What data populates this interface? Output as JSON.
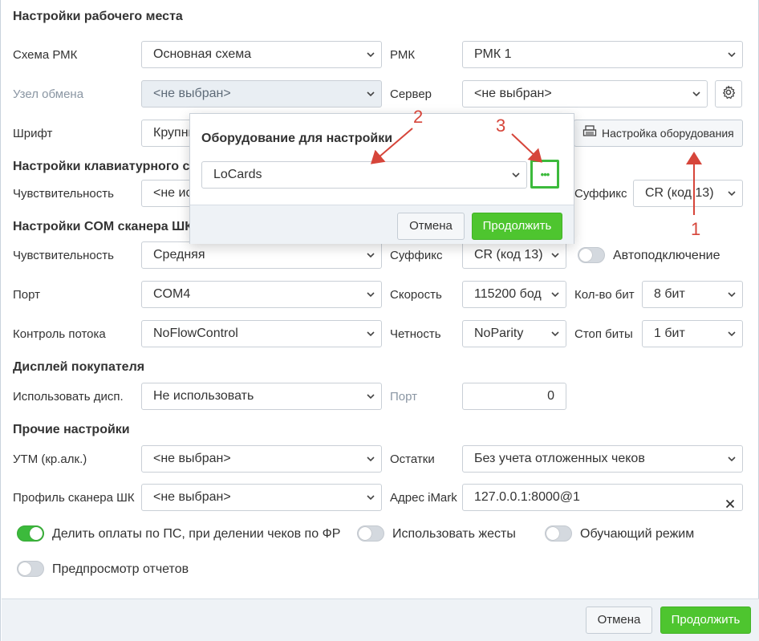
{
  "sections": {
    "workplace": "Настройки рабочего места",
    "keyboard": "Настройки клавиатурного с",
    "com_scanner": "Настройки COM сканера ШК",
    "display": "Дисплей покупателя",
    "other": "Прочие настройки"
  },
  "workplace": {
    "scheme_label": "Схема РМК",
    "scheme_value": "Основная схема",
    "rmk_label": "РМК",
    "rmk_value": "РМК 1",
    "node_label": "Узел обмена",
    "node_value": "<не выбран>",
    "server_label": "Сервер",
    "server_value": "<не выбран>",
    "font_label": "Шрифт",
    "font_value": "Крупны",
    "equipment_button": "Настройка оборудования"
  },
  "keyboard": {
    "sensitivity_label": "Чувствительность",
    "sensitivity_value": "<не ис",
    "suffix_label": "Суффикс",
    "suffix_value": "CR (код 13)"
  },
  "com": {
    "sensitivity_label": "Чувствительность",
    "sensitivity_value": "Средняя",
    "suffix_label": "Суффикс",
    "suffix_value": "CR (код 13)",
    "autoconnect_label": "Автоподключение",
    "autoconnect_on": false,
    "port_label": "Порт",
    "port_value": "COM4",
    "speed_label": "Скорость",
    "speed_value": "115200 бод",
    "bits_label": "Кол-во бит",
    "bits_value": "8 бит",
    "flow_label": "Контроль потока",
    "flow_value": "NoFlowControl",
    "parity_label": "Четность",
    "parity_value": "NoParity",
    "stop_label": "Стоп биты",
    "stop_value": "1 бит"
  },
  "display": {
    "use_label": "Использовать дисп.",
    "use_value": "Не использовать",
    "port_label": "Порт",
    "port_value": "0"
  },
  "other": {
    "utm_label": "УТМ (кр.алк.)",
    "utm_value": "<не выбран>",
    "rest_label": "Остатки",
    "rest_value": "Без учета отложенных чеков",
    "profile_label": "Профиль сканера ШК",
    "profile_value": "<не выбран>",
    "imark_label": "Адрес iMark",
    "imark_value": "127.0.0.1:8000@1"
  },
  "toggles": {
    "split_label": "Делить оплаты по ПС, при делении чеков по ФР",
    "split_on": true,
    "gestures_label": "Использовать жесты",
    "gestures_on": false,
    "training_label": "Обучающий режим",
    "training_on": false,
    "preview_label": "Предпросмотр отчетов",
    "preview_on": false
  },
  "footer": {
    "cancel": "Отмена",
    "continue": "Продолжить"
  },
  "modal": {
    "title": "Оборудование для настройки",
    "equipment_value": "LoCards",
    "more_button": "•••",
    "cancel": "Отмена",
    "continue": "Продолжить"
  },
  "annotations": {
    "a1": "1",
    "a2": "2",
    "a3": "3"
  },
  "colors": {
    "primary": "#4ec52f",
    "annotation": "#d6453a",
    "highlight": "#3cba3c"
  }
}
